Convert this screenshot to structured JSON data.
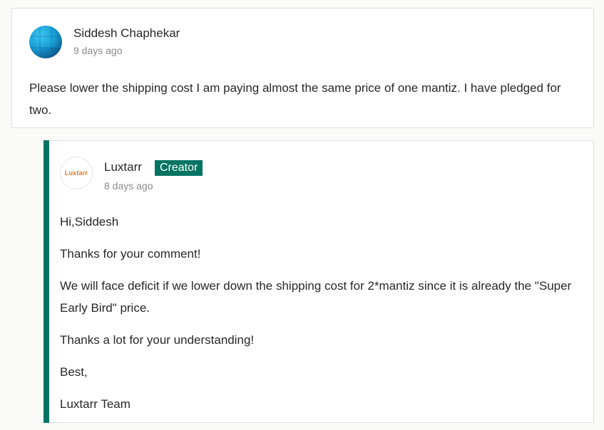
{
  "comment": {
    "author": "Siddesh Chaphekar",
    "timestamp": "9 days ago",
    "body": "Please lower the shipping cost I am paying almost the same price of one mantiz. I have pledged for two."
  },
  "reply": {
    "author": "Luxtarr",
    "badge": "Creator",
    "avatar_text": "Luxtarr",
    "timestamp": "8 days ago",
    "paragraphs": [
      "Hi,Siddesh",
      "Thanks for your comment!",
      "We will face deficit if we lower down the shipping cost for 2*mantiz since it is already the \"Super Early Bird\" price.",
      "Thanks a lot for your understanding!",
      "Best,",
      "Luxtarr Team"
    ]
  },
  "colors": {
    "accent": "#037362",
    "logo_text": "#e07a1f",
    "avatar_blue": "#1a9fd6"
  },
  "icons": {
    "comment_avatar": "globe-avatar-icon",
    "reply_avatar": "luxtarr-logo-avatar"
  }
}
